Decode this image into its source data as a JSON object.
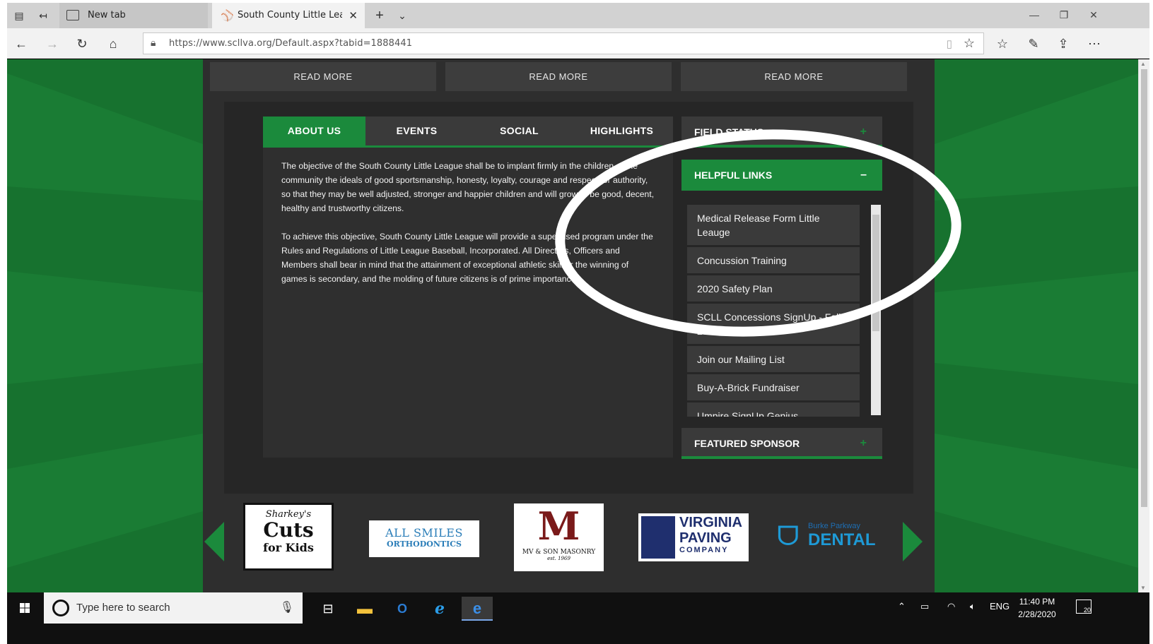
{
  "browser": {
    "tabs": [
      {
        "title": "New tab"
      },
      {
        "title": "South County Little League"
      }
    ],
    "url": "https://www.scllva.org/Default.aspx?tabid=1888441",
    "url_host": "www.scllva.org"
  },
  "page": {
    "read_more": [
      "READ MORE",
      "READ MORE",
      "READ MORE"
    ],
    "tabs": [
      {
        "label": "ABOUT US",
        "active": true
      },
      {
        "label": "EVENTS",
        "active": false
      },
      {
        "label": "SOCIAL",
        "active": false
      },
      {
        "label": "HIGHLIGHTS",
        "active": false
      }
    ],
    "about": {
      "p1": "The objective of the South County Little League shall be to implant firmly in the children of the community the ideals of good sportsmanship, honesty, loyalty, courage and respect for authority, so that they may be well adjusted, stronger and happier children and will grow to be good, decent, healthy and trustworthy citizens.",
      "p2": "To achieve this objective, South County Little League will provide a supervised program under the Rules and Regulations of Little League Baseball, Incorporated. All Directors, Officers and Members shall bear in mind that the attainment of exceptional athletic skill or the winning of games is secondary, and the molding of future citizens is of prime importance."
    },
    "widgets": {
      "field_status": {
        "title": "FIELD STATUS",
        "toggle": "+"
      },
      "helpful_links": {
        "title": "HELPFUL LINKS",
        "toggle": "–",
        "items": [
          "Medical Release Form Little Leauge",
          "Concussion Training",
          "2020 Safety Plan",
          "SCLL Concessions SignUp - Fall 2019",
          "Join our Mailing List",
          "Buy-A-Brick Fundraiser",
          "Umpire SignUp Genius"
        ]
      },
      "featured_sponsor": {
        "title": "FEATURED SPONSOR",
        "toggle": "+"
      }
    },
    "sponsors": [
      {
        "name": "Sharkey's Cuts for Kids",
        "line1": "Sharkey's",
        "line2": "Cuts",
        "line3": "for Kids"
      },
      {
        "name": "All Smiles Orthodontics",
        "line1": "ALL SMILES",
        "line2": "ORTHODONTICS"
      },
      {
        "name": "MV & Son Masonry",
        "line1": "MV & SON MASONRY",
        "line2": "est. 1969"
      },
      {
        "name": "Virginia Paving Company",
        "line1": "VIRGINIA",
        "line2": "PAVING",
        "line3": "COMPANY"
      },
      {
        "name": "Burke Parkway Dental",
        "line1": "Burke Parkway",
        "line2": "DENTAL"
      }
    ],
    "colors": {
      "green": "#1b8a3c",
      "dark": "#2e2e2e",
      "background": "#17722f"
    }
  },
  "taskbar": {
    "search_placeholder": "Type here to search",
    "language": "ENG",
    "time": "11:40 PM",
    "date": "2/28/2020",
    "notifications": "20"
  }
}
